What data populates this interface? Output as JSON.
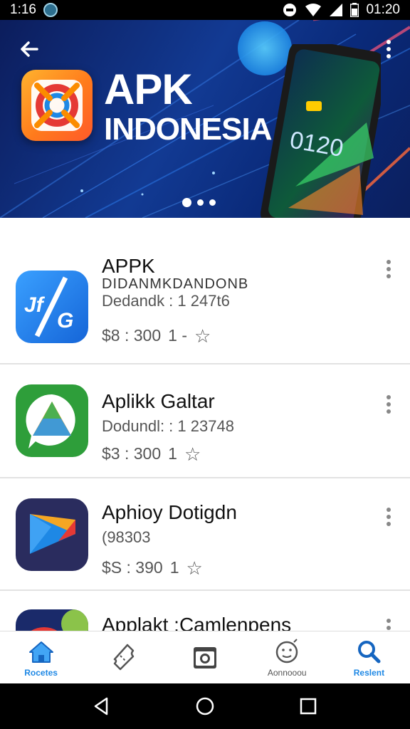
{
  "status_bar": {
    "time_left": "1:16",
    "time_right": "01:20"
  },
  "banner": {
    "title_line1": "APK",
    "title_line2": "INDONESIA",
    "phone_time": "0120",
    "pager_count": 3,
    "pager_active": 0
  },
  "apps": [
    {
      "name": "APPK",
      "subtitle": "DIDANMKDANDONB",
      "downloads": "Dedandk : 1 247t6",
      "price": "$8 : 300",
      "rating": "1 -",
      "icon": "blue-app-icon"
    },
    {
      "name": "Aplikk Galtar",
      "downloads": "Dodundl: : 1 23748",
      "price": "$3 : 300",
      "rating": "1",
      "icon": "green-app-icon"
    },
    {
      "name": "Aphioy Dotigdn",
      "downloads": "(98303",
      "price": "$S : 390",
      "rating": "1",
      "icon": "purple-app-icon"
    },
    {
      "name": "Applakt :Camlenpens",
      "icon": "partial-app-icon"
    }
  ],
  "bottom_nav": [
    {
      "label": "Rocetes",
      "icon": "home-icon",
      "active": true
    },
    {
      "label": "",
      "icon": "ticket-icon",
      "active": false
    },
    {
      "label": "",
      "icon": "camera-icon",
      "active": false
    },
    {
      "label": "Aonnooou",
      "icon": "smiley-icon",
      "active": false
    },
    {
      "label": "Reslent",
      "icon": "search-icon",
      "active": true
    }
  ],
  "colors": {
    "banner_bg": "#123a93",
    "accent": "#1e88e5",
    "text_primary": "#111111",
    "text_secondary": "#555555"
  }
}
